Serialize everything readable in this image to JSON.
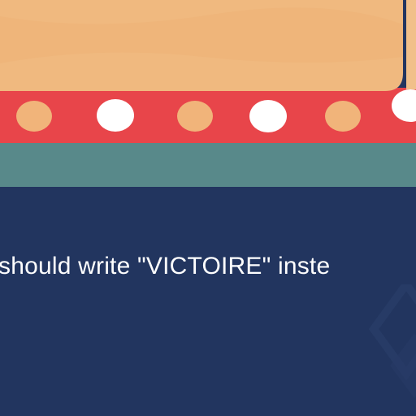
{
  "message": {
    "text": "should write \"VICTOIRE\" inste"
  },
  "colors": {
    "background": "#22355f",
    "banner_cream": "#f0b97f",
    "banner_red": "#e8454a",
    "banner_teal": "#58898a",
    "dot_peach": "#f1b47a",
    "dot_white": "#ffffff",
    "text": "#ffffff"
  },
  "banner": {
    "dots": [
      {
        "kind": "peach"
      },
      {
        "kind": "white"
      },
      {
        "kind": "peach"
      },
      {
        "kind": "white"
      },
      {
        "kind": "peach"
      },
      {
        "kind": "white"
      }
    ]
  }
}
